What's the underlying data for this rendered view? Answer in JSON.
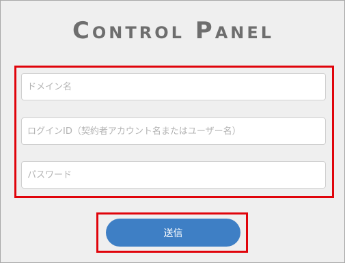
{
  "header": {
    "title": "Control Panel"
  },
  "form": {
    "domain_placeholder": "ドメイン名",
    "login_placeholder": "ログインID（契約者アカウント名またはユーザー名）",
    "password_placeholder": "パスワード",
    "submit_label": "送信"
  },
  "colors": {
    "highlight_border": "#e0040b",
    "button_bg": "#3e7fc5",
    "title_text": "#6e6e6e",
    "page_bg": "#efefef"
  }
}
